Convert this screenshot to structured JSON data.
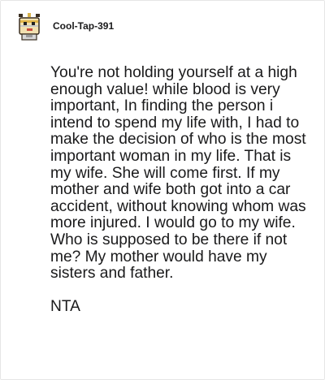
{
  "comment": {
    "author": {
      "username": "Cool-Tap-391",
      "avatar_icon": "snoo-avatar-icon"
    },
    "paragraphs": [
      "You're not holding yourself at a high enough value! while blood is very important, In finding the person i intend to spend my life with, I had to make the decision of who is the most important woman in my life. That is my wife. She will come first. If my mother and wife both got into a car accident, without knowing whom was more injured. I would go to my wife. Who is supposed to be there if not me? My mother would have my sisters and father.",
      "NTA"
    ]
  }
}
